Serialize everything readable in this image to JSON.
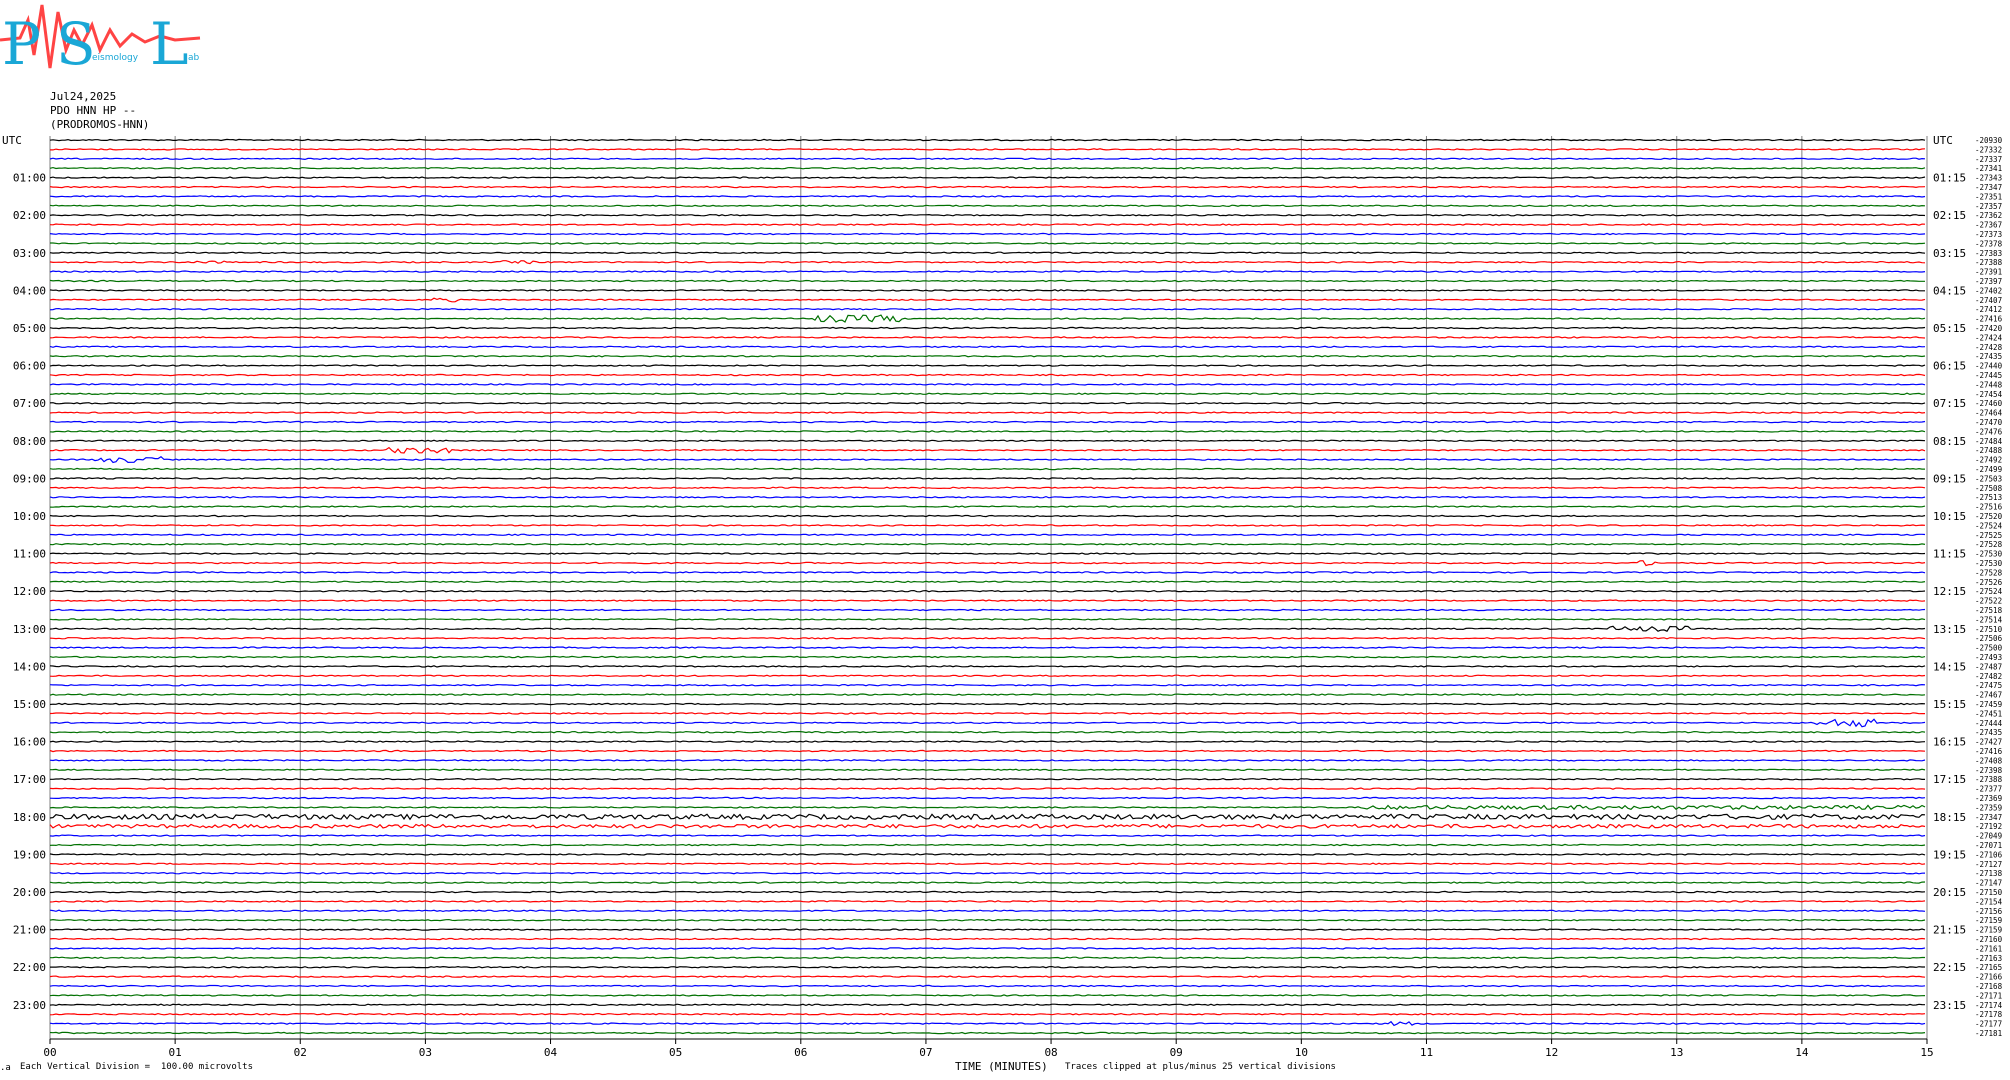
{
  "logo": {
    "letters": [
      "P",
      "S",
      "L"
    ],
    "words": [
      "",
      "eismology",
      "ab"
    ]
  },
  "header": {
    "date": "Jul24,2025",
    "station": "PDO HNN HP --",
    "location": "(PRODROMOS-HNN)"
  },
  "colors": {
    "trace_cycle": [
      "#000000",
      "#ff0000",
      "#0000ff",
      "#007000"
    ],
    "grid": "#7f7f7f",
    "logo_red": "#ff4444",
    "logo_blue": "#1aa7d6"
  },
  "chart_data": {
    "type": "line",
    "title": "",
    "xlabel": "TIME (MINUTES)",
    "ylabel": "",
    "xlim": [
      0,
      15
    ],
    "x_ticks": [
      "00",
      "01",
      "02",
      "03",
      "04",
      "05",
      "06",
      "07",
      "08",
      "09",
      "10",
      "11",
      "12",
      "13",
      "14",
      "15"
    ],
    "left_labels": [
      "UTC",
      "01:00",
      "02:00",
      "03:00",
      "04:00",
      "05:00",
      "06:00",
      "07:00",
      "08:00",
      "09:00",
      "10:00",
      "11:00",
      "12:00",
      "13:00",
      "14:00",
      "15:00",
      "16:00",
      "17:00",
      "18:00",
      "19:00",
      "20:00",
      "21:00",
      "22:00",
      "23:00"
    ],
    "right_labels": [
      "UTC",
      "01:15",
      "02:15",
      "03:15",
      "04:15",
      "05:15",
      "06:15",
      "07:15",
      "08:15",
      "09:15",
      "10:15",
      "11:15",
      "12:15",
      "13:15",
      "14:15",
      "15:15",
      "16:15",
      "17:15",
      "18:15",
      "19:15",
      "20:15",
      "21:15",
      "22:15",
      "23:15"
    ],
    "trace_offsets": [
      -20930,
      -27332,
      -27337,
      -27341,
      -27343,
      -27347,
      -27351,
      -27357,
      -27362,
      -27367,
      -27373,
      -27378,
      -27383,
      -27388,
      -27391,
      -27397,
      -27402,
      -27407,
      -27412,
      -27416,
      -27420,
      -27424,
      -27428,
      -27435,
      -27440,
      -27445,
      -27448,
      -27454,
      -27460,
      -27464,
      -27470,
      -27476,
      -27484,
      -27488,
      -27492,
      -27499,
      -27503,
      -27508,
      -27513,
      -27516,
      -27520,
      -27524,
      -27525,
      -27528,
      -27530,
      -27530,
      -27528,
      -27526,
      -27524,
      -27522,
      -27518,
      -27514,
      -27510,
      -27506,
      -27500,
      -27493,
      -27487,
      -27482,
      -27475,
      -27467,
      -27459,
      -27451,
      -27444,
      -27435,
      -27427,
      -27416,
      -27408,
      -27398,
      -27388,
      -27377,
      -27369,
      -27359,
      -27347,
      -27192,
      -27049,
      -27071,
      -27106,
      -27127,
      -27138,
      -27147,
      -27150,
      -27154,
      -27156,
      -27159,
      -27159,
      -27160,
      -27161,
      -27163,
      -27165,
      -27166,
      -27168,
      -27171,
      -27174,
      -27178,
      -27177,
      -27181
    ],
    "events": [
      {
        "trace": 13,
        "start_min": 1.1,
        "end_min": 1.4,
        "amplitude": 1.2
      },
      {
        "trace": 13,
        "start_min": 3.6,
        "end_min": 3.9,
        "amplitude": 1.5
      },
      {
        "trace": 17,
        "start_min": 3.05,
        "end_min": 3.25,
        "amplitude": 2.0
      },
      {
        "trace": 19,
        "start_min": 6.1,
        "end_min": 6.8,
        "amplitude": 3.5
      },
      {
        "trace": 33,
        "start_min": 2.7,
        "end_min": 3.2,
        "amplitude": 3.0
      },
      {
        "trace": 34,
        "start_min": 0.35,
        "end_min": 0.9,
        "amplitude": 3.0
      },
      {
        "trace": 45,
        "start_min": 12.7,
        "end_min": 12.85,
        "amplitude": 2.5
      },
      {
        "trace": 52,
        "start_min": 12.4,
        "end_min": 13.1,
        "amplitude": 2.5
      },
      {
        "trace": 62,
        "start_min": 14.1,
        "end_min": 14.6,
        "amplitude": 4.0
      },
      {
        "trace": 71,
        "start_min": 10.5,
        "end_min": 15.0,
        "amplitude": 2.0
      },
      {
        "trace": 72,
        "start_min": 0.0,
        "end_min": 15.0,
        "amplitude": 2.5
      },
      {
        "trace": 73,
        "start_min": 0.0,
        "end_min": 15.0,
        "amplitude": 1.8
      },
      {
        "trace": 94,
        "start_min": 10.7,
        "end_min": 10.9,
        "amplitude": 2.0
      }
    ]
  },
  "footer": {
    "left_mark": ".a",
    "scale_note": "Each Vertical Division =  100.00 microvolts",
    "clip_note": "Traces clipped at plus/minus 25 vertical divisions"
  }
}
